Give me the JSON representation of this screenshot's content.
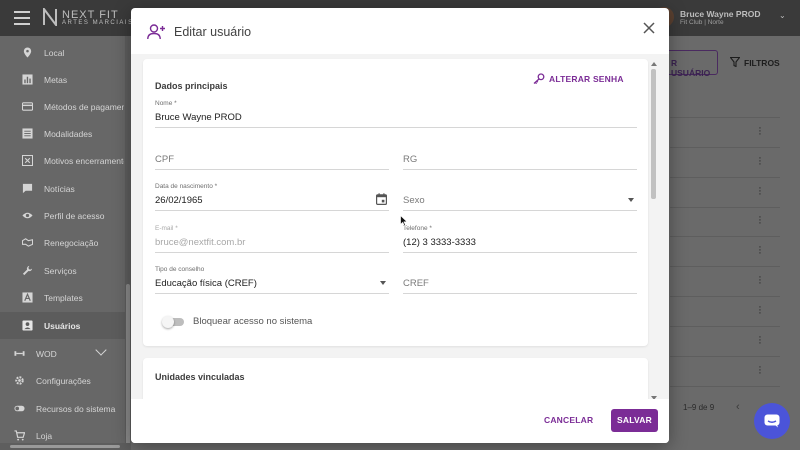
{
  "header": {
    "brand_line1": "NEXT FIT",
    "brand_line2": "ARTES MARCIAIS",
    "user_name": "Bruce Wayne PROD",
    "user_club": "Fit Club | Norte"
  },
  "sidebar": {
    "items": [
      {
        "label": "Local",
        "icon": "location-pin-icon"
      },
      {
        "label": "Metas",
        "icon": "chart-icon"
      },
      {
        "label": "Métodos de pagamento",
        "icon": "credit-card-icon"
      },
      {
        "label": "Modalidades",
        "icon": "list-icon"
      },
      {
        "label": "Motivos encerramento",
        "icon": "close-box-icon"
      },
      {
        "label": "Notícias",
        "icon": "chat-bubble-icon"
      },
      {
        "label": "Perfil de acesso",
        "icon": "eye-icon"
      },
      {
        "label": "Renegociação",
        "icon": "handshake-icon"
      },
      {
        "label": "Serviços",
        "icon": "wrench-icon"
      },
      {
        "label": "Templates",
        "icon": "text-template-icon"
      },
      {
        "label": "Usuários",
        "icon": "user-badge-icon"
      },
      {
        "label": "WOD",
        "icon": "dumbbell-icon"
      },
      {
        "label": "Configurações",
        "icon": "gear-icon"
      },
      {
        "label": "Recursos do sistema",
        "icon": "toggle-icon"
      },
      {
        "label": "Loja",
        "icon": "cart-icon"
      }
    ]
  },
  "background": {
    "add_user_button": "R USUÁRIO",
    "filters_button": "FILTROS",
    "pagination": "1–9 de 9"
  },
  "modal": {
    "title": "Editar usuário",
    "section_main": "Dados principais",
    "change_password": "ALTERAR SENHA",
    "fields": {
      "name": {
        "label": "Nome *",
        "value": "Bruce Wayne PROD"
      },
      "cpf": {
        "placeholder": "CPF"
      },
      "rg": {
        "placeholder": "RG"
      },
      "birth": {
        "label": "Data de nascimento *",
        "value": "26/02/1965"
      },
      "sex": {
        "placeholder": "Sexo"
      },
      "email": {
        "label": "E-mail *",
        "value": "bruce@nextfit.com.br"
      },
      "phone": {
        "label": "Telefone *",
        "value": "(12) 3 3333-3333"
      },
      "council_type": {
        "label": "Tipo de conselho",
        "value": "Educação física (CREF)"
      },
      "cref": {
        "placeholder": "CREF"
      }
    },
    "block_access": "Bloquear acesso no sistema",
    "block_access_on": false,
    "section_units": "Unidades vinculadas",
    "cancel": "CANCELAR",
    "save": "SALVAR"
  },
  "colors": {
    "accent": "#7b2c96",
    "chat": "#4b54d9"
  }
}
